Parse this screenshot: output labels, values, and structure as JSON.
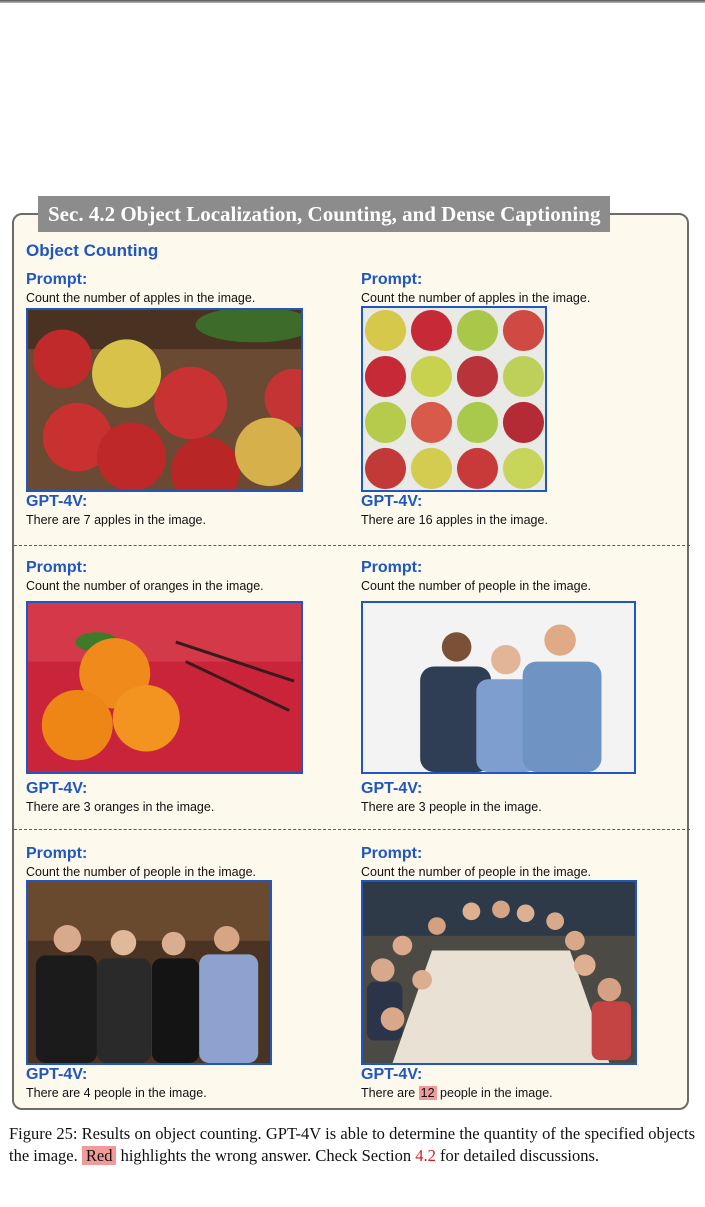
{
  "section_title": "Sec. 4.2 Object Localization, Counting, and Dense Captioning",
  "subheading": "Object Counting",
  "labels": {
    "prompt": "Prompt:",
    "answer": "GPT-4V:"
  },
  "cells": [
    {
      "prompt": "Count the number of apples in the image.",
      "answer": "There are 7 apples in the image."
    },
    {
      "prompt": "Count the number of apples in the image.",
      "answer": "There are 16 apples in the image."
    },
    {
      "prompt": "Count the number of oranges in the image.",
      "answer": "There are 3 oranges in the image."
    },
    {
      "prompt": "Count the number of people in the image.",
      "answer": "There are 3 people in the image."
    },
    {
      "prompt": "Count the number of people in the image.",
      "answer": "There are 4 people in the image."
    },
    {
      "prompt": "Count the number of people in the image.",
      "answer_pre": "There are ",
      "answer_wrong": "12",
      "answer_post": " people in the image."
    }
  ],
  "caption": {
    "part1": "Figure 25: Results on object counting. GPT-4V is able to determine the quantity of the specified objects the image. ",
    "highlight": "Red",
    "part2": " highlights the wrong answer. Check Section ",
    "ref": "4.2",
    "part3": " for detailed discussions."
  },
  "colors": {
    "label_blue": "#1f56c2",
    "panel_bg": "#fdf9ec",
    "highlight_red": "#f09a9a",
    "title_bar": "#8c8c8c"
  }
}
